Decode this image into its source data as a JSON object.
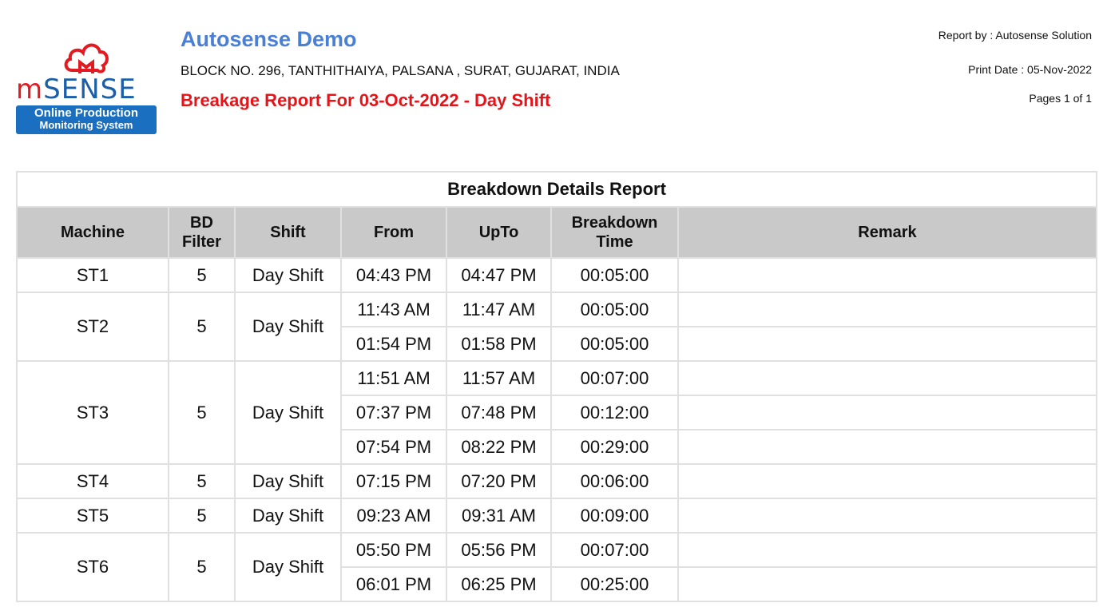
{
  "logo": {
    "word_red": "m",
    "word_blue": "SENSE",
    "badge_line1": "Online Production",
    "badge_line2": "Monitoring System",
    "cloud_icon": "cloud-logo-icon",
    "colors": {
      "red": "#e21b23",
      "blue": "#1a5fa8",
      "badge": "#1a6fc0"
    }
  },
  "header": {
    "company": "Autosense Demo",
    "address": "BLOCK NO. 296, TANTHITHAIYA, PALSANA , SURAT, GUJARAT, INDIA",
    "title": "Breakage Report For 03-Oct-2022 - Day Shift",
    "report_by": "Report by : Autosense Solution",
    "print_date": "Print Date : 05-Nov-2022",
    "pages": "Pages 1 of 1",
    "colors": {
      "company": "#4a7fd6",
      "title": "#e3151a"
    }
  },
  "table": {
    "caption": "Breakdown Details Report",
    "columns": {
      "machine": "Machine",
      "bd_filter_1": "BD",
      "bd_filter_2": "Filter",
      "shift": "Shift",
      "from": "From",
      "upto": "UpTo",
      "bd_time_1": "Breakdown",
      "bd_time_2": "Time",
      "remark": "Remark"
    },
    "groups": [
      {
        "machine": "ST1",
        "bd_filter": "5",
        "shift": "Day Shift",
        "entries": [
          {
            "from": "04:43 PM",
            "upto": "04:47 PM",
            "time": "00:05:00",
            "remark": ""
          }
        ]
      },
      {
        "machine": "ST2",
        "bd_filter": "5",
        "shift": "Day Shift",
        "entries": [
          {
            "from": "11:43 AM",
            "upto": "11:47 AM",
            "time": "00:05:00",
            "remark": ""
          },
          {
            "from": "01:54 PM",
            "upto": "01:58 PM",
            "time": "00:05:00",
            "remark": ""
          }
        ]
      },
      {
        "machine": "ST3",
        "bd_filter": "5",
        "shift": "Day Shift",
        "entries": [
          {
            "from": "11:51 AM",
            "upto": "11:57 AM",
            "time": "00:07:00",
            "remark": ""
          },
          {
            "from": "07:37 PM",
            "upto": "07:48 PM",
            "time": "00:12:00",
            "remark": ""
          },
          {
            "from": "07:54 PM",
            "upto": "08:22 PM",
            "time": "00:29:00",
            "remark": ""
          }
        ]
      },
      {
        "machine": "ST4",
        "bd_filter": "5",
        "shift": "Day Shift",
        "entries": [
          {
            "from": "07:15 PM",
            "upto": "07:20 PM",
            "time": "00:06:00",
            "remark": ""
          }
        ]
      },
      {
        "machine": "ST5",
        "bd_filter": "5",
        "shift": "Day Shift",
        "entries": [
          {
            "from": "09:23 AM",
            "upto": "09:31 AM",
            "time": "00:09:00",
            "remark": ""
          }
        ]
      },
      {
        "machine": "ST6",
        "bd_filter": "5",
        "shift": "Day Shift",
        "entries": [
          {
            "from": "05:50 PM",
            "upto": "05:56 PM",
            "time": "00:07:00",
            "remark": ""
          },
          {
            "from": "06:01 PM",
            "upto": "06:25 PM",
            "time": "00:25:00",
            "remark": ""
          }
        ]
      }
    ]
  }
}
